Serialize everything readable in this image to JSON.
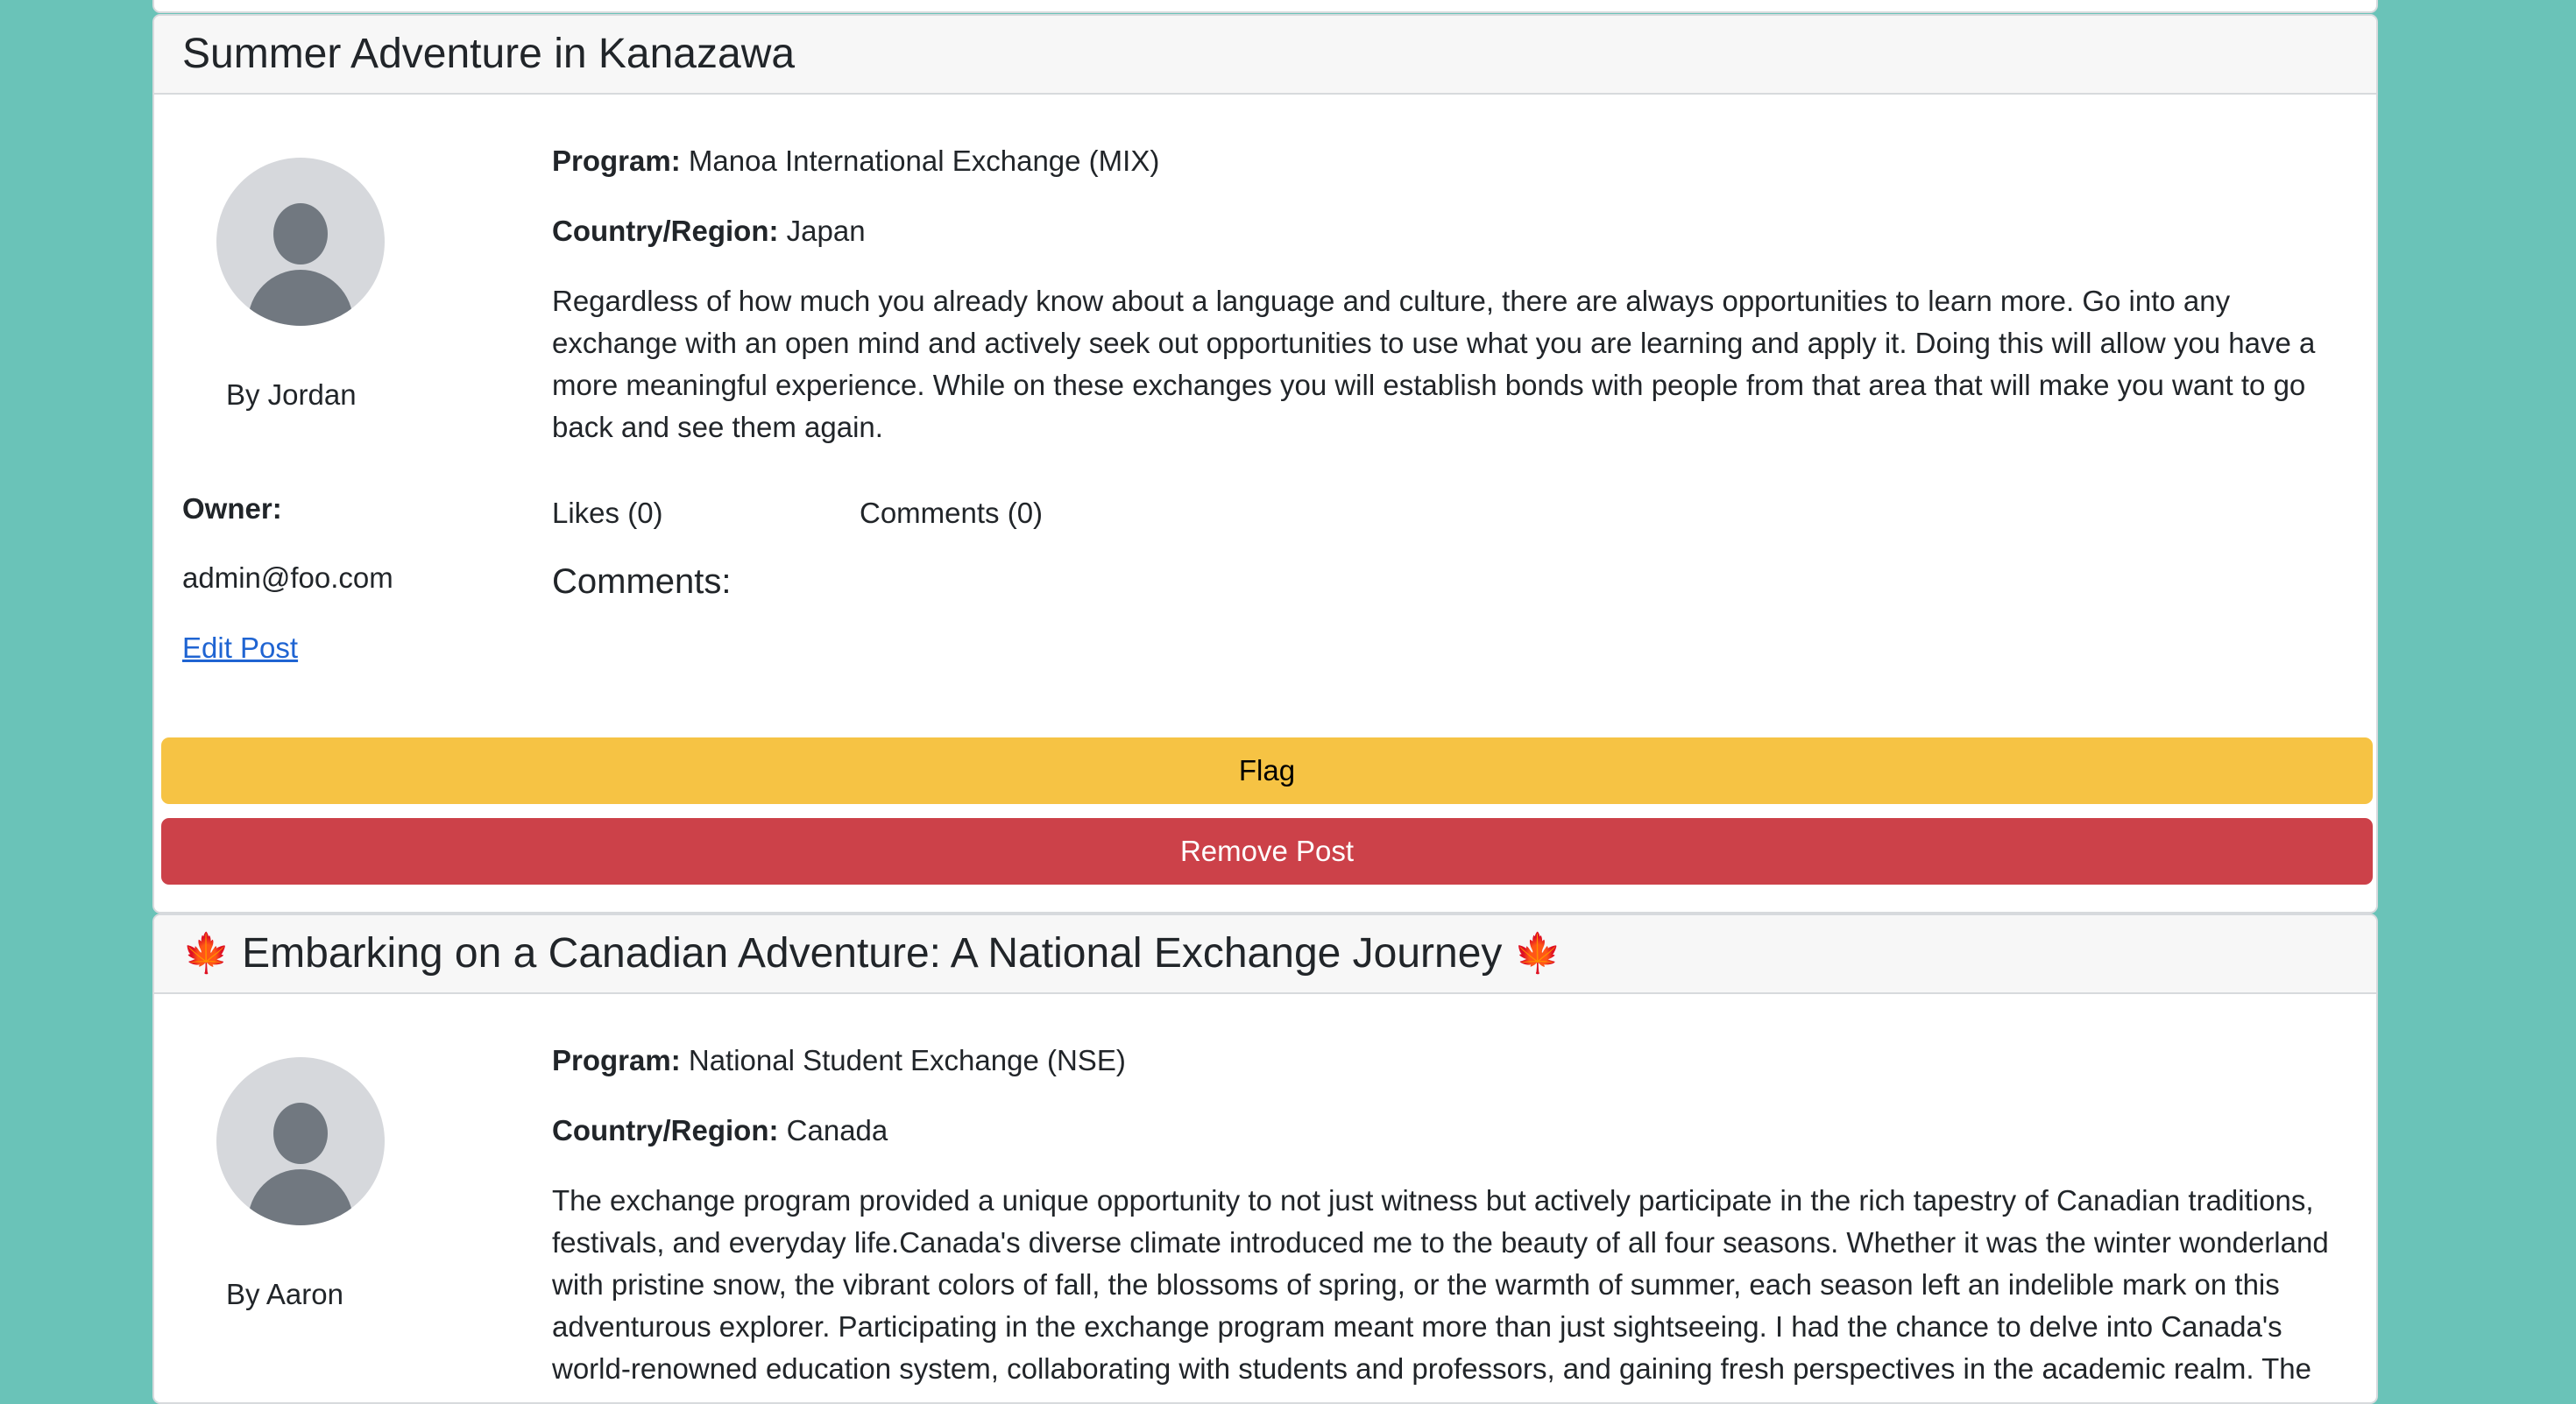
{
  "colors": {
    "page_background": "#6ac3b8",
    "flag_button": "#f6c344",
    "remove_button": "#cc4149",
    "link": "#1f64d2",
    "avatar_bg": "#d6d8dc",
    "avatar_figure": "#717880"
  },
  "labels": {
    "program": "Program:",
    "country": "Country/Region:"
  },
  "posts": [
    {
      "title": "Summer Adventure in Kanazawa",
      "author": "By Jordan",
      "program": "Manoa International Exchange (MIX)",
      "country": "Japan",
      "description": "Regardless of how much you already know about a language and culture, there are always opportunities to learn more. Go into any exchange with an open mind and actively seek out opportunities to use what you are learning and apply it. Doing this will allow you have a more meaningful experience. While on these exchanges you will establish bonds with people from that area that will make you want to go back and see them again.",
      "likes": "Likes (0)",
      "comments_count": "Comments (0)",
      "comments_heading": "Comments:",
      "owner_label": "Owner:",
      "owner": "admin@foo.com",
      "edit_link": "Edit Post",
      "flag_button": "Flag",
      "remove_button": "Remove Post"
    },
    {
      "title": "Embarking on a Canadian Adventure: A National Exchange Journey",
      "title_icon": "maple-leaf-icon",
      "title_icon_glyph": "🍁",
      "author": "By Aaron",
      "program": "National Student Exchange (NSE)",
      "country": "Canada",
      "description": "The exchange program provided a unique opportunity to not just witness but actively participate in the rich tapestry of Canadian traditions, festivals, and everyday life.Canada's diverse climate introduced me to the beauty of all four seasons. Whether it was the winter wonderland with pristine snow, the vibrant colors of fall, the blossoms of spring, or the warmth of summer, each season left an indelible mark on this adventurous explorer. Participating in the exchange program meant more than just sightseeing. I had the chance to delve into Canada's world-renowned education system, collaborating with students and professors, and gaining fresh perspectives in the academic realm. The"
    }
  ]
}
